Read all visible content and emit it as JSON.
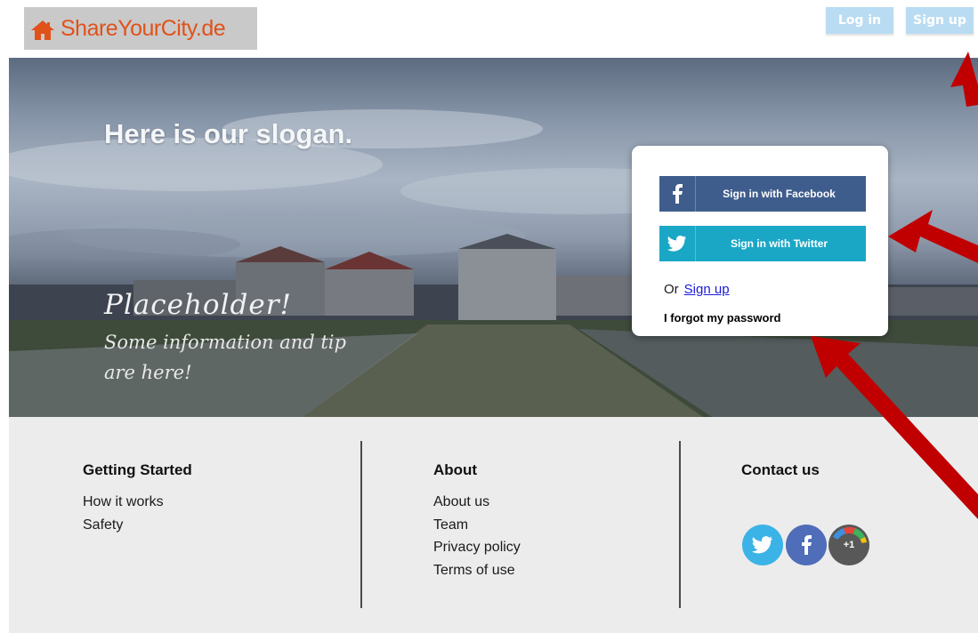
{
  "header": {
    "logo_text": "ShareYourCity.de",
    "login_label": "Log in",
    "signup_label": "Sign up"
  },
  "hero": {
    "slogan": "Here is our slogan.",
    "placeholder_title": "Placeholder!",
    "placeholder_info": "Some information and tip are here!"
  },
  "login_card": {
    "facebook_label": "Sign in with Facebook",
    "twitter_label": "Sign in with Twitter",
    "or_text": "Or",
    "signup_link": "Sign up",
    "forgot_label": "I forgot my password"
  },
  "footer": {
    "getting_started": {
      "title": "Getting Started",
      "links": [
        "How it works",
        "Safety"
      ]
    },
    "about": {
      "title": "About",
      "links": [
        "About us",
        "Team",
        "Privacy policy",
        "Terms of use"
      ]
    },
    "contact": {
      "title": "Contact us",
      "gplus_label": "+1"
    }
  },
  "colors": {
    "logo_text": "#e0521a",
    "header_button": "#b9dcf3",
    "facebook": "#3f5d8c",
    "twitter": "#1aa7c6",
    "link": "#1a1ad6",
    "footer_bg": "#ececec",
    "annotation_arrow": "#c00000"
  },
  "icons": {
    "logo": "house-icon",
    "facebook": "facebook-icon",
    "twitter": "twitter-bird-icon",
    "gplus": "google-plus-one-icon"
  }
}
